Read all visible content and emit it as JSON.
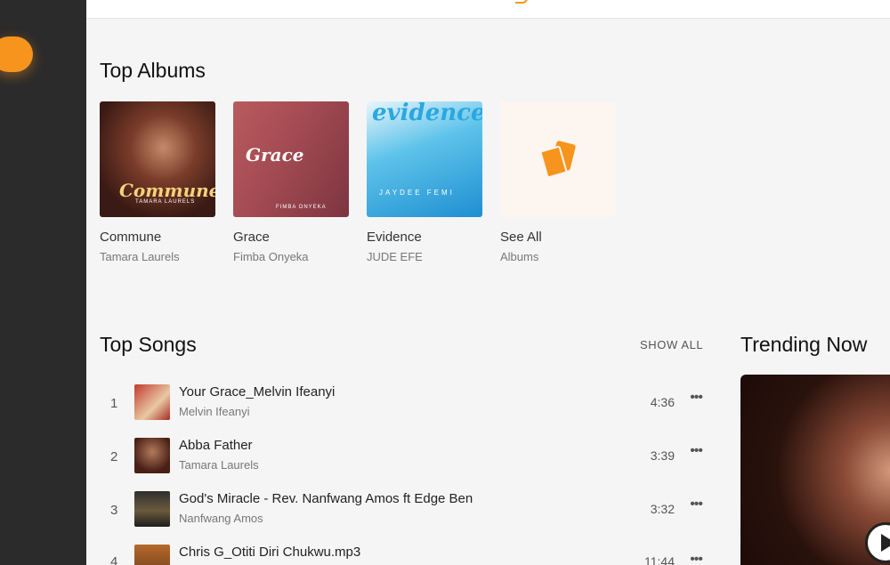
{
  "sections": {
    "top_albums": "Top Albums",
    "top_songs": "Top Songs",
    "trending_now": "Trending Now",
    "show_all": "SHOW ALL"
  },
  "albums": [
    {
      "title": "Commune",
      "artist": "Tamara Laurels",
      "art_text": "Commune",
      "art_sub": "TAMARA LAURELS"
    },
    {
      "title": "Grace",
      "artist": "Fimba Onyeka",
      "art_text": "Grace",
      "art_sub": "FIMBA ONYEKA"
    },
    {
      "title": "Evidence",
      "artist": "JUDE EFE",
      "art_text": "evidence",
      "art_sub": "JAYDEE FEMI"
    },
    {
      "title": "See All",
      "artist": "Albums"
    }
  ],
  "songs": [
    {
      "num": "1",
      "title": "Your Grace_Melvin Ifeanyi",
      "artist": "Melvin Ifeanyi",
      "duration": "4:36"
    },
    {
      "num": "2",
      "title": "Abba Father",
      "artist": "Tamara Laurels",
      "duration": "3:39"
    },
    {
      "num": "3",
      "title": "God's Miracle - Rev. Nanfwang Amos ft Edge Ben",
      "artist": "Nanfwang Amos",
      "duration": "3:32"
    },
    {
      "num": "4",
      "title": "Chris G_Otiti Diri Chukwu.mp3",
      "artist": "",
      "duration": "11:44"
    }
  ],
  "more_glyph": "•••",
  "colors": {
    "accent": "#f7941d",
    "sidebar": "#2b2b2b",
    "background": "#f5f5f5"
  }
}
